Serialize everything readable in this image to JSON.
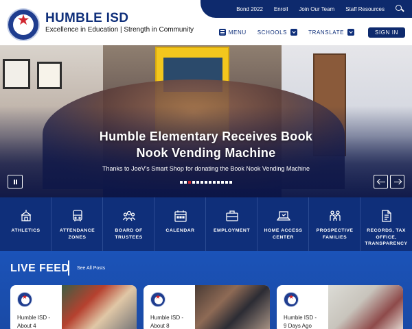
{
  "header": {
    "title": "HUMBLE ISD",
    "tagline": "Excellence in Education | Strength in Community",
    "colors": {
      "navy": "#0e2a6d",
      "brand_blue": "#0f2f7a",
      "accent_red": "#d0262f"
    }
  },
  "topbar": {
    "links": [
      "Bond 2022",
      "Enroll",
      "Join Our Team",
      "Staff Resources"
    ],
    "search_icon": "search-icon"
  },
  "mainnav": {
    "menu_label": "MENU",
    "schools_label": "SCHOOLS",
    "translate_label": "TRANSLATE",
    "signin_label": "SIGN IN"
  },
  "hero": {
    "headline_line1": "Humble Elementary Receives Book",
    "headline_line2": "Nook Vending Machine",
    "caption": "Thanks to JoeV's Smart Shop for donating the Book Nook Vending Machine",
    "slide_count": 13,
    "active_slide": 2
  },
  "quicklinks": [
    {
      "label": "ATHLETICS",
      "icon": "stadium-icon"
    },
    {
      "label": "ATTENDANCE ZONES",
      "icon": "bus-icon"
    },
    {
      "label": "BOARD OF TRUSTEES",
      "icon": "people-icon"
    },
    {
      "label": "CALENDAR",
      "icon": "calendar-icon"
    },
    {
      "label": "EMPLOYMENT",
      "icon": "briefcase-icon"
    },
    {
      "label": "HOME ACCESS CENTER",
      "icon": "laptop-icon"
    },
    {
      "label": "PROSPECTIVE FAMILIES",
      "icon": "family-icon"
    },
    {
      "label": "RECORDS, TAX OFFICE, TRANSPARENCY",
      "icon": "document-icon"
    }
  ],
  "livefeed": {
    "title": "LIVE FEED",
    "see_all": "See All Posts",
    "cards": [
      {
        "name": "Humble ISD -",
        "time": "About 4"
      },
      {
        "name": "Humble ISD -",
        "time": "About 8"
      },
      {
        "name": "Humble ISD -",
        "time": "9 Days Ago"
      }
    ]
  }
}
